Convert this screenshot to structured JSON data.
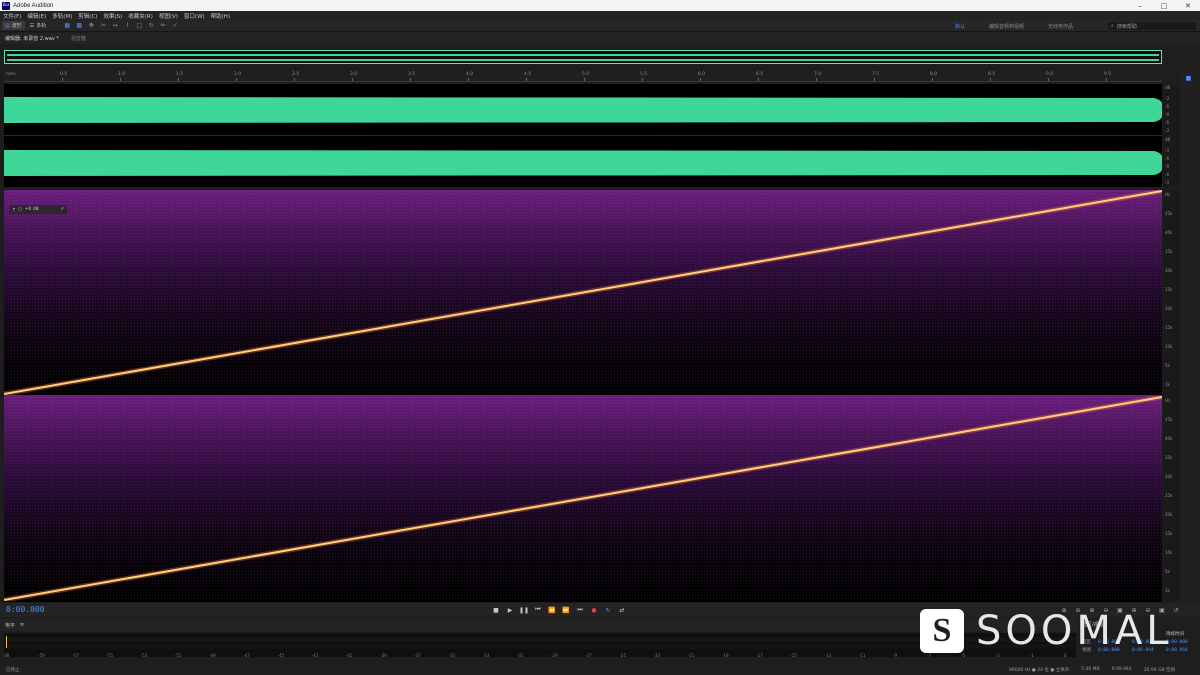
{
  "window": {
    "title": "Adobe Audition",
    "app_icon": "Au"
  },
  "menu": [
    "文件(F)",
    "编辑(E)",
    "多轨(M)",
    "剪辑(C)",
    "效果(S)",
    "收藏夹(R)",
    "视图(V)",
    "窗口(W)",
    "帮助(H)"
  ],
  "toolbar": {
    "waveform_label": "波形",
    "multitrack_label": "多轨"
  },
  "workspaces": [
    "默认",
    "编辑音频到视频",
    "无线电作品"
  ],
  "search": {
    "placeholder": "搜索帮助"
  },
  "panel_tabs": {
    "editor": "编辑器: 未录音 2.wav *",
    "mixer": "混音器"
  },
  "ruler": {
    "start": "hms",
    "ticks": [
      "0.5",
      "1.0",
      "1.5",
      "2.0",
      "2.5",
      "3.0",
      "3.5",
      "4.0",
      "4.5",
      "5.0",
      "5.5",
      "6.0",
      "6.5",
      "7.0",
      "7.5",
      "8.0",
      "8.5",
      "9.0",
      "9.5"
    ]
  },
  "db_scale": [
    "dB",
    "-3",
    "-6",
    "-9",
    "-6",
    "-3",
    "dB",
    "-3",
    "-6",
    "-9",
    "-6",
    "-3"
  ],
  "hz_scale_ch1": [
    "Hz",
    "45k",
    "40k",
    "35k",
    "30k",
    "25k",
    "20k",
    "15k",
    "10k",
    "5k",
    "1k"
  ],
  "hz_scale_ch2": [
    "Hz",
    "45k",
    "40k",
    "35k",
    "30k",
    "25k",
    "20k",
    "15k",
    "10k",
    "5k",
    "1k"
  ],
  "hud": {
    "gain": "+0 dB"
  },
  "transport": {
    "time": "0:00.000"
  },
  "levels": {
    "tab": "电平",
    "scale": [
      "dB",
      "-59",
      "-57",
      "-55",
      "-53",
      "-51",
      "-49",
      "-47",
      "-45",
      "-43",
      "-41",
      "-39",
      "-37",
      "-35",
      "-33",
      "-31",
      "-29",
      "-27",
      "-25",
      "-23",
      "-21",
      "-19",
      "-17",
      "-15",
      "-13",
      "-11",
      "-9",
      "-7",
      "-5",
      "-3",
      "-1",
      "0"
    ]
  },
  "selection_panel": {
    "title": "选区/视图",
    "rows": [
      {
        "label": "选区",
        "start": "0:00.000",
        "end": "0:00.000",
        "dur": "0:00.000"
      },
      {
        "label": "视图",
        "start": "0:00.000",
        "end": "0:09.944",
        "dur": "0:09.944"
      }
    ],
    "col_dur": "持续时间"
  },
  "status": {
    "left": "已停止",
    "rate": "96000 Hz ● 24 位 ● 立体声",
    "size": "5.46 MB",
    "dur": "0:09.944",
    "free": "30.94 GB 空闲"
  },
  "watermark": {
    "logo": "S",
    "text": "SOOMAL"
  },
  "colors": {
    "wave": "#3fd69a",
    "accent": "#4a90ff",
    "sweep": "#ffd27a",
    "record": "#e84040"
  }
}
